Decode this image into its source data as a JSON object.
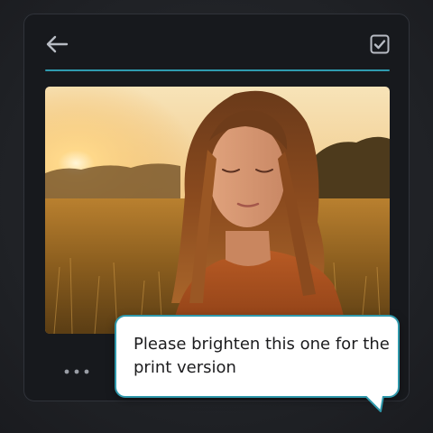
{
  "header": {
    "back_icon": "arrow-left-icon",
    "done_icon": "checkbox-checked-icon"
  },
  "colors": {
    "accent": "#2f9bb0",
    "panel_bg": "#17191d",
    "page_bg": "#202226",
    "bubble_bg": "#ffffff"
  },
  "photo": {
    "subject": "photo-woman-in-golden-field"
  },
  "toolbar": {
    "more_icon": "more-horizontal-icon"
  },
  "comment": {
    "text": "Please brighten this one for the print version"
  }
}
